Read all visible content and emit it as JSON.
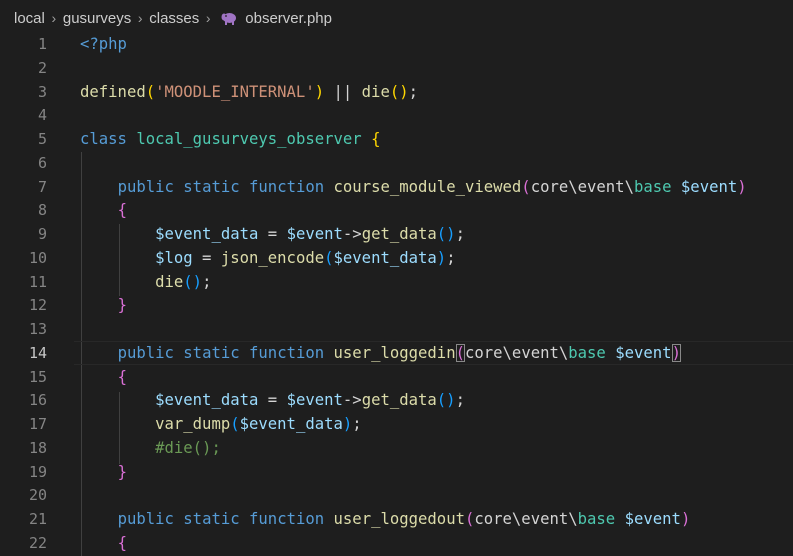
{
  "breadcrumb": {
    "items": [
      "local",
      "gusurveys",
      "classes"
    ],
    "file": "observer.php",
    "separator": "›"
  },
  "editor": {
    "current_line": 14,
    "lines": [
      {
        "n": "1",
        "tokens": [
          {
            "t": "<?php",
            "c": "k"
          }
        ]
      },
      {
        "n": "2",
        "tokens": []
      },
      {
        "n": "3",
        "tokens": [
          {
            "t": "defined",
            "c": "f"
          },
          {
            "t": "(",
            "c": "p1"
          },
          {
            "t": "'MOODLE_INTERNAL'",
            "c": "s"
          },
          {
            "t": ")",
            "c": "p1"
          },
          {
            "t": " || ",
            "c": "d"
          },
          {
            "t": "die",
            "c": "f"
          },
          {
            "t": "()",
            "c": "p1"
          },
          {
            "t": ";",
            "c": "d"
          }
        ]
      },
      {
        "n": "4",
        "tokens": []
      },
      {
        "n": "5",
        "tokens": [
          {
            "t": "class",
            "c": "k"
          },
          {
            "t": " ",
            "c": "d"
          },
          {
            "t": "local_gusurveys_observer",
            "c": "t"
          },
          {
            "t": " ",
            "c": "d"
          },
          {
            "t": "{",
            "c": "p1"
          }
        ]
      },
      {
        "n": "6",
        "tokens": []
      },
      {
        "n": "7",
        "tokens": [
          {
            "t": "    ",
            "c": "d"
          },
          {
            "t": "public",
            "c": "k"
          },
          {
            "t": " ",
            "c": "d"
          },
          {
            "t": "static",
            "c": "k"
          },
          {
            "t": " ",
            "c": "d"
          },
          {
            "t": "function",
            "c": "k"
          },
          {
            "t": " ",
            "c": "d"
          },
          {
            "t": "course_module_viewed",
            "c": "f"
          },
          {
            "t": "(",
            "c": "p2"
          },
          {
            "t": "core\\event\\",
            "c": "d"
          },
          {
            "t": "base",
            "c": "t"
          },
          {
            "t": " ",
            "c": "d"
          },
          {
            "t": "$event",
            "c": "v"
          },
          {
            "t": ")",
            "c": "p2"
          }
        ]
      },
      {
        "n": "8",
        "tokens": [
          {
            "t": "    ",
            "c": "d"
          },
          {
            "t": "{",
            "c": "p2"
          }
        ]
      },
      {
        "n": "9",
        "tokens": [
          {
            "t": "        ",
            "c": "d"
          },
          {
            "t": "$event_data",
            "c": "v"
          },
          {
            "t": " = ",
            "c": "d"
          },
          {
            "t": "$event",
            "c": "v"
          },
          {
            "t": "->",
            "c": "d"
          },
          {
            "t": "get_data",
            "c": "f"
          },
          {
            "t": "()",
            "c": "p3"
          },
          {
            "t": ";",
            "c": "d"
          }
        ]
      },
      {
        "n": "10",
        "tokens": [
          {
            "t": "        ",
            "c": "d"
          },
          {
            "t": "$log",
            "c": "v"
          },
          {
            "t": " = ",
            "c": "d"
          },
          {
            "t": "json_encode",
            "c": "f"
          },
          {
            "t": "(",
            "c": "p3"
          },
          {
            "t": "$event_data",
            "c": "v"
          },
          {
            "t": ")",
            "c": "p3"
          },
          {
            "t": ";",
            "c": "d"
          }
        ]
      },
      {
        "n": "11",
        "tokens": [
          {
            "t": "        ",
            "c": "d"
          },
          {
            "t": "die",
            "c": "f"
          },
          {
            "t": "()",
            "c": "p3"
          },
          {
            "t": ";",
            "c": "d"
          }
        ]
      },
      {
        "n": "12",
        "tokens": [
          {
            "t": "    ",
            "c": "d"
          },
          {
            "t": "}",
            "c": "p2"
          }
        ]
      },
      {
        "n": "13",
        "tokens": []
      },
      {
        "n": "14",
        "tokens": [
          {
            "t": "    ",
            "c": "d"
          },
          {
            "t": "public",
            "c": "k"
          },
          {
            "t": " ",
            "c": "d"
          },
          {
            "t": "static",
            "c": "k"
          },
          {
            "t": " ",
            "c": "d"
          },
          {
            "t": "function",
            "c": "k"
          },
          {
            "t": " ",
            "c": "d"
          },
          {
            "t": "user_loggedin",
            "c": "f"
          },
          {
            "t": "(",
            "c": "p2 pm"
          },
          {
            "t": "core\\event\\",
            "c": "d"
          },
          {
            "t": "base",
            "c": "t"
          },
          {
            "t": " ",
            "c": "d"
          },
          {
            "t": "$event",
            "c": "v"
          },
          {
            "t": ")",
            "c": "p2 pm"
          }
        ]
      },
      {
        "n": "15",
        "tokens": [
          {
            "t": "    ",
            "c": "d"
          },
          {
            "t": "{",
            "c": "p2"
          }
        ]
      },
      {
        "n": "16",
        "tokens": [
          {
            "t": "        ",
            "c": "d"
          },
          {
            "t": "$event_data",
            "c": "v"
          },
          {
            "t": " = ",
            "c": "d"
          },
          {
            "t": "$event",
            "c": "v"
          },
          {
            "t": "->",
            "c": "d"
          },
          {
            "t": "get_data",
            "c": "f"
          },
          {
            "t": "()",
            "c": "p3"
          },
          {
            "t": ";",
            "c": "d"
          }
        ]
      },
      {
        "n": "17",
        "tokens": [
          {
            "t": "        ",
            "c": "d"
          },
          {
            "t": "var_dump",
            "c": "f"
          },
          {
            "t": "(",
            "c": "p3"
          },
          {
            "t": "$event_data",
            "c": "v"
          },
          {
            "t": ")",
            "c": "p3"
          },
          {
            "t": ";",
            "c": "d"
          }
        ]
      },
      {
        "n": "18",
        "tokens": [
          {
            "t": "        ",
            "c": "d"
          },
          {
            "t": "#die();",
            "c": "c"
          }
        ]
      },
      {
        "n": "19",
        "tokens": [
          {
            "t": "    ",
            "c": "d"
          },
          {
            "t": "}",
            "c": "p2"
          }
        ]
      },
      {
        "n": "20",
        "tokens": []
      },
      {
        "n": "21",
        "tokens": [
          {
            "t": "    ",
            "c": "d"
          },
          {
            "t": "public",
            "c": "k"
          },
          {
            "t": " ",
            "c": "d"
          },
          {
            "t": "static",
            "c": "k"
          },
          {
            "t": " ",
            "c": "d"
          },
          {
            "t": "function",
            "c": "k"
          },
          {
            "t": " ",
            "c": "d"
          },
          {
            "t": "user_loggedout",
            "c": "f"
          },
          {
            "t": "(",
            "c": "p2"
          },
          {
            "t": "core\\event\\",
            "c": "d"
          },
          {
            "t": "base",
            "c": "t"
          },
          {
            "t": " ",
            "c": "d"
          },
          {
            "t": "$event",
            "c": "v"
          },
          {
            "t": ")",
            "c": "p2"
          }
        ]
      },
      {
        "n": "22",
        "tokens": [
          {
            "t": "    ",
            "c": "d"
          },
          {
            "t": "{",
            "c": "p2"
          }
        ]
      }
    ]
  }
}
